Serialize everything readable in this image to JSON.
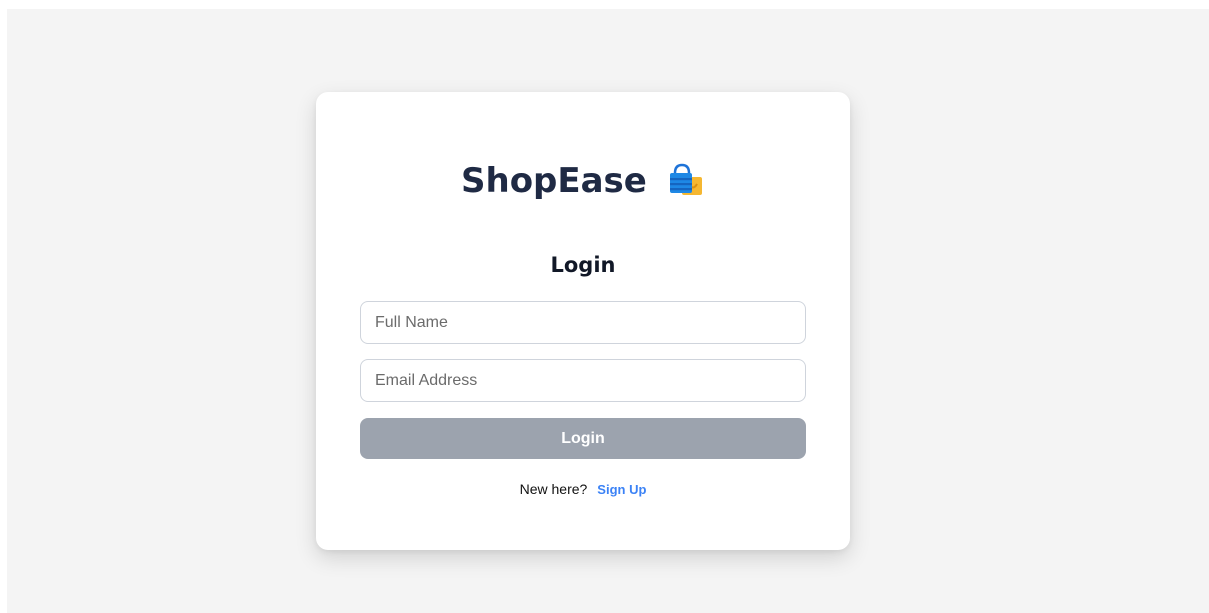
{
  "brand": {
    "title": "ShopEase",
    "icon": "shopping-bags-icon"
  },
  "form": {
    "heading": "Login",
    "full_name_placeholder": "Full Name",
    "full_name_value": "",
    "email_placeholder": "Email Address",
    "email_value": "",
    "submit_label": "Login"
  },
  "footer": {
    "prompt": "New here?",
    "signup_label": "Sign Up"
  },
  "colors": {
    "background": "#f4f4f4",
    "card": "#ffffff",
    "title_text": "#1f2a44",
    "button_disabled": "#9ca3ae",
    "link": "#3b82f6"
  }
}
